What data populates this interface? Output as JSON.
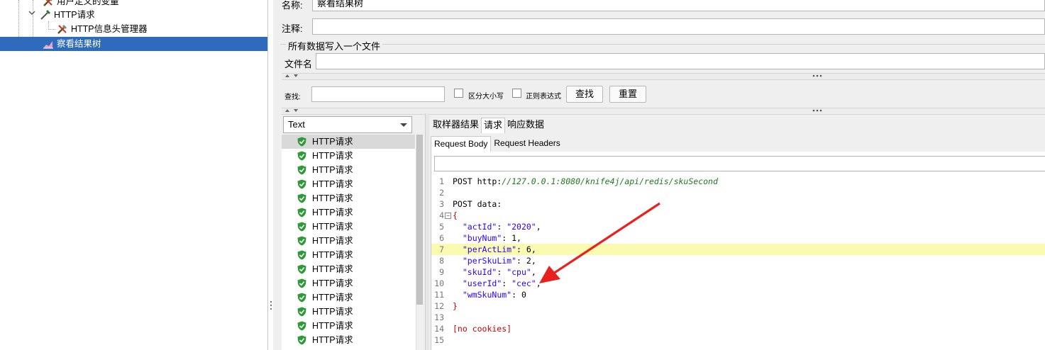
{
  "tree": {
    "items": [
      {
        "label": "用户定义的变量",
        "icon": "wrench-icon",
        "indent": 1
      },
      {
        "label": "HTTP请求",
        "icon": "pipette-icon",
        "indent": 1
      },
      {
        "label": "HTTP信息头管理器",
        "icon": "wrench-icon",
        "indent": 2
      },
      {
        "label": "察看结果树",
        "icon": "chart-icon",
        "indent": 1,
        "selected": true
      }
    ]
  },
  "form": {
    "name_label": "名称:",
    "name_value": "察看结果树",
    "comment_label": "注释:",
    "comment_value": "",
    "write_all_label": "所有数据写入一个文件",
    "filename_label": "文件名",
    "filename_value": ""
  },
  "search": {
    "label": "查找:",
    "case_label": "区分大小写",
    "regex_label": "正则表达式",
    "find_button": "查找",
    "reset_button": "重置"
  },
  "renderer": {
    "selected": "Text"
  },
  "results": {
    "items": [
      "HTTP请求",
      "HTTP请求",
      "HTTP请求",
      "HTTP请求",
      "HTTP请求",
      "HTTP请求",
      "HTTP请求",
      "HTTP请求",
      "HTTP请求",
      "HTTP请求",
      "HTTP请求",
      "HTTP请求",
      "HTTP请求",
      "HTTP请求",
      "HTTP请求"
    ]
  },
  "tabs": {
    "items": [
      "取样器结果",
      "请求",
      "响应数据"
    ],
    "active": "请求"
  },
  "subtabs": {
    "items": [
      "Request Body",
      "Request Headers"
    ],
    "active": "Request Body"
  },
  "code": {
    "lines": [
      {
        "n": "1",
        "method": "POST http:",
        "url": "//127.0.0.1:8080/knife4j/api/redis/skuSecond"
      },
      {
        "n": "2",
        "text": ""
      },
      {
        "n": "3",
        "text": "POST data:"
      },
      {
        "n": "4",
        "text": "{",
        "fold": true
      },
      {
        "n": "5",
        "key": "\"actId\"",
        "sep": ": ",
        "val": "\"2020\"",
        "end": ","
      },
      {
        "n": "6",
        "key": "\"buyNum\"",
        "sep": ": ",
        "val": "1",
        "end": ","
      },
      {
        "n": "7",
        "key": "\"perActLim\"",
        "sep": ": ",
        "val": "6",
        "end": ",",
        "highlight": true
      },
      {
        "n": "8",
        "key": "\"perSkuLim\"",
        "sep": ": ",
        "val": "2",
        "end": ","
      },
      {
        "n": "9",
        "key": "\"skuId\"",
        "sep": ": ",
        "val": "\"cpu\"",
        "end": ","
      },
      {
        "n": "10",
        "key": "\"userId\"",
        "sep": ": ",
        "val": "\"cec\"",
        "end": ","
      },
      {
        "n": "11",
        "key": "\"wmSkuNum\"",
        "sep": ": ",
        "val": "0",
        "end": ""
      },
      {
        "n": "12",
        "text": "}"
      },
      {
        "n": "13",
        "text": ""
      },
      {
        "n": "14",
        "text": "[no cookies]"
      },
      {
        "n": "15",
        "text": ""
      }
    ]
  },
  "colors": {
    "selection": "#2f6bbd",
    "annotation_arrow": "#e8201e",
    "highlight_line": "#fafab0"
  }
}
